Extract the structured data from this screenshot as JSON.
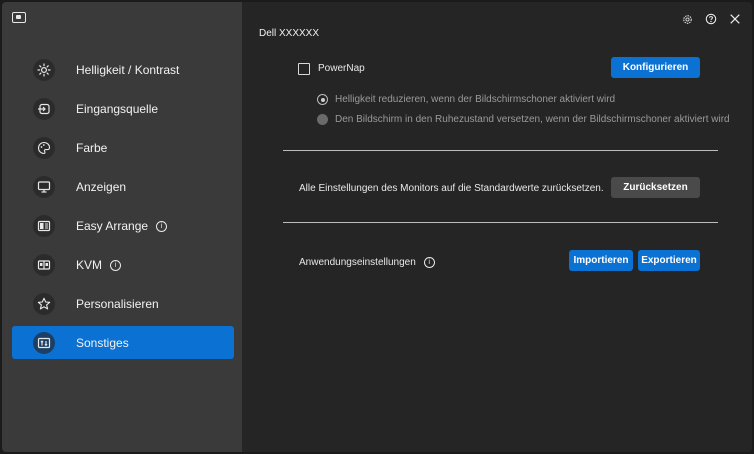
{
  "sidebar": {
    "items": [
      {
        "label": "Helligkeit / Kontrast",
        "icon": "brightness-icon",
        "info": false
      },
      {
        "label": "Eingangsquelle",
        "icon": "input-source-icon",
        "info": false
      },
      {
        "label": "Farbe",
        "icon": "color-icon",
        "info": false
      },
      {
        "label": "Anzeigen",
        "icon": "display-icon",
        "info": false
      },
      {
        "label": "Easy Arrange",
        "icon": "easy-arrange-icon",
        "info": true
      },
      {
        "label": "KVM",
        "icon": "kvm-icon",
        "info": true
      },
      {
        "label": "Personalisieren",
        "icon": "star-icon",
        "info": false
      },
      {
        "label": "Sonstiges",
        "icon": "others-icon",
        "info": false,
        "active": true
      }
    ]
  },
  "header": {
    "device_name": "Dell XXXXXX",
    "icons": [
      "settings-icon",
      "help-icon",
      "close-icon"
    ]
  },
  "powernap": {
    "checkbox_label": "PowerNap",
    "checked": false,
    "configure_button": "Konfigurieren",
    "options": [
      {
        "label": "Helligkeit reduzieren, wenn der Bildschirmschoner aktiviert wird",
        "selected": true
      },
      {
        "label": "Den Bildschirm in den Ruhezustand versetzen, wenn der Bildschirmschoner aktiviert wird",
        "selected": false
      }
    ]
  },
  "reset": {
    "text": "Alle Einstellungen des Monitors auf die Standardwerte zurücksetzen.",
    "button": "Zurücksetzen"
  },
  "app_settings": {
    "label": "Anwendungseinstellungen",
    "import_button": "Importieren",
    "export_button": "Exportieren"
  },
  "colors": {
    "accent": "#0b72d4",
    "sidebar_bg": "#3a3a3b",
    "main_bg": "#252526"
  }
}
